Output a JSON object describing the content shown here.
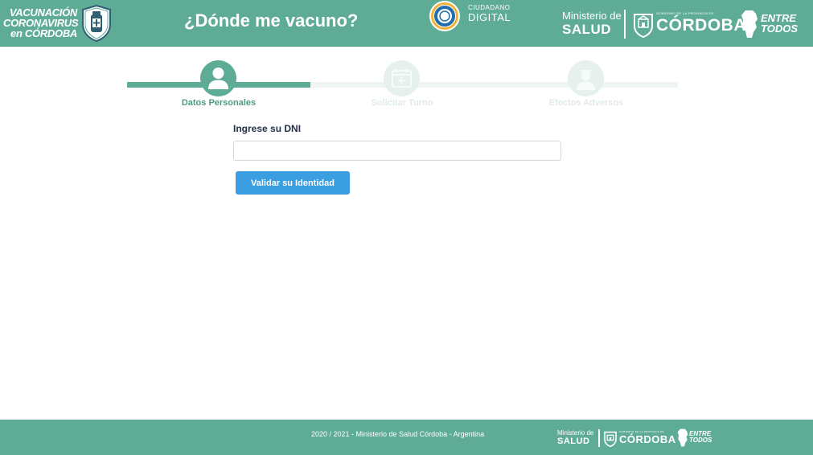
{
  "header": {
    "vacunacion_logo": {
      "line1": "VACUNACIÓN",
      "line2": "CORONAVIRUS",
      "line3": "en CÓRDOBA"
    },
    "title": "¿Dónde me vacuno?",
    "ciudadano_digital": {
      "line1": "CIUDADANO",
      "line2": "DIGITAL"
    },
    "ministerio": {
      "line1": "Ministerio de",
      "line2": "SALUD"
    },
    "cordoba": {
      "gobierno": "GOBIERNO DE LA PROVINCIA DE",
      "name": "CÓRDOBA"
    },
    "entre_todos": {
      "line1": "ENTRE",
      "line2": "TODOS"
    }
  },
  "stepper": {
    "steps": [
      {
        "label": "Datos Personales",
        "icon": "person-icon",
        "state": "active"
      },
      {
        "label": "Solicitar Turno",
        "icon": "calendar-icon",
        "state": "inactive"
      },
      {
        "label": "Efectos Adversos",
        "icon": "nurse-icon",
        "state": "inactive"
      }
    ],
    "progress_fraction": 0.333
  },
  "form": {
    "dni_label": "Ingrese su DNI",
    "dni_value": "",
    "dni_placeholder": "",
    "submit_label": "Validar su Identidad"
  },
  "footer": {
    "copyright": "2020 / 2021 - Ministerio de Salud Córdoba - Argentina",
    "ministerio": {
      "line1": "Ministerio de",
      "line2": "SALUD"
    },
    "cordoba": {
      "gobierno": "GOBIERNO DE LA PROVINCIA DE",
      "name": "CÓRDOBA"
    },
    "entre_todos": {
      "line1": "ENTRE",
      "line2": "TODOS"
    }
  },
  "colors": {
    "brand_green": "#5fac96",
    "button_blue": "#3a9ee0",
    "label_navy": "#243048"
  }
}
